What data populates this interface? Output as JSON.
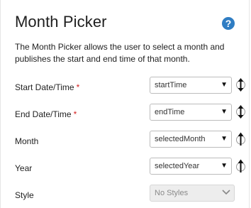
{
  "panel": {
    "title": "Month Picker",
    "help_icon": "question-circle-icon",
    "description": "The Month Picker allows the user to select a month and publishes the start and end time of that month."
  },
  "fields": [
    {
      "label": "Start Date/Time",
      "required": "*",
      "value": "startTime",
      "binding_icon": "bidirectional-binding-icon"
    },
    {
      "label": "End Date/Time",
      "required": "*",
      "value": "endTime",
      "binding_icon": "bidirectional-binding-icon"
    },
    {
      "label": "Month",
      "value": "selectedMonth",
      "binding_icon": "output-binding-icon"
    },
    {
      "label": "Year",
      "value": "selectedYear",
      "binding_icon": "output-binding-icon"
    },
    {
      "label": "Style",
      "value": "No Styles"
    }
  ],
  "colors": {
    "accent": "#2f7dc3",
    "required": "#d31f1f",
    "disabled_bg": "#ededed"
  }
}
